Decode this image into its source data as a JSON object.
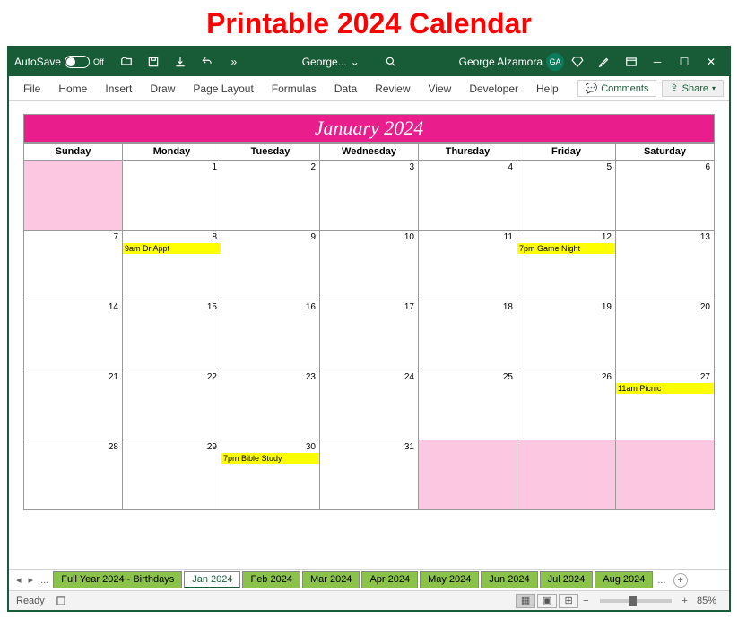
{
  "page_title": "Printable 2024 Calendar",
  "titlebar": {
    "autosave_label": "AutoSave",
    "autosave_state": "Off",
    "filename": "George...",
    "username": "George Alzamora",
    "initials": "GA"
  },
  "ribbon": {
    "tabs": [
      "File",
      "Home",
      "Insert",
      "Draw",
      "Page Layout",
      "Formulas",
      "Data",
      "Review",
      "View",
      "Developer",
      "Help"
    ],
    "comments": "Comments",
    "share": "Share"
  },
  "calendar": {
    "month_title": "January 2024",
    "days": [
      "Sunday",
      "Monday",
      "Tuesday",
      "Wednesday",
      "Thursday",
      "Friday",
      "Saturday"
    ],
    "weeks": [
      [
        {
          "n": "",
          "pink": true
        },
        {
          "n": "1"
        },
        {
          "n": "2"
        },
        {
          "n": "3"
        },
        {
          "n": "4"
        },
        {
          "n": "5"
        },
        {
          "n": "6"
        }
      ],
      [
        {
          "n": "7"
        },
        {
          "n": "8",
          "ev": "9am Dr Appt"
        },
        {
          "n": "9"
        },
        {
          "n": "10"
        },
        {
          "n": "11"
        },
        {
          "n": "12",
          "ev": "7pm Game Night"
        },
        {
          "n": "13"
        }
      ],
      [
        {
          "n": "14"
        },
        {
          "n": "15"
        },
        {
          "n": "16"
        },
        {
          "n": "17"
        },
        {
          "n": "18"
        },
        {
          "n": "19"
        },
        {
          "n": "20"
        }
      ],
      [
        {
          "n": "21"
        },
        {
          "n": "22"
        },
        {
          "n": "23"
        },
        {
          "n": "24"
        },
        {
          "n": "25"
        },
        {
          "n": "26"
        },
        {
          "n": "27",
          "ev": "11am Picnic"
        }
      ],
      [
        {
          "n": "28"
        },
        {
          "n": "29"
        },
        {
          "n": "30",
          "ev": "7pm Bible Study"
        },
        {
          "n": "31"
        },
        {
          "n": "",
          "pink": true
        },
        {
          "n": "",
          "pink": true
        },
        {
          "n": "",
          "pink": true
        }
      ]
    ]
  },
  "sheet_tabs": {
    "items": [
      "Full Year 2024 - Birthdays",
      "Jan 2024",
      "Feb 2024",
      "Mar 2024",
      "Apr 2024",
      "May 2024",
      "Jun 2024",
      "Jul 2024",
      "Aug 2024"
    ],
    "active": "Jan 2024",
    "ellipsis": "..."
  },
  "statusbar": {
    "ready": "Ready",
    "zoom": "85%"
  }
}
